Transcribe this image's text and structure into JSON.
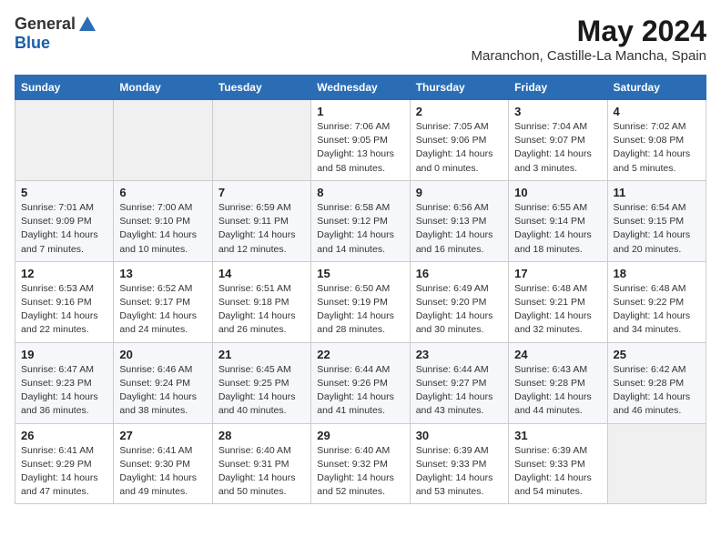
{
  "header": {
    "logo_general": "General",
    "logo_blue": "Blue",
    "main_title": "May 2024",
    "subtitle": "Maranchon, Castille-La Mancha, Spain"
  },
  "weekdays": [
    "Sunday",
    "Monday",
    "Tuesday",
    "Wednesday",
    "Thursday",
    "Friday",
    "Saturday"
  ],
  "weeks": [
    [
      {
        "day": "",
        "empty": true
      },
      {
        "day": "",
        "empty": true
      },
      {
        "day": "",
        "empty": true
      },
      {
        "day": "1",
        "info": "Sunrise: 7:06 AM\nSunset: 9:05 PM\nDaylight: 13 hours\nand 58 minutes."
      },
      {
        "day": "2",
        "info": "Sunrise: 7:05 AM\nSunset: 9:06 PM\nDaylight: 14 hours\nand 0 minutes."
      },
      {
        "day": "3",
        "info": "Sunrise: 7:04 AM\nSunset: 9:07 PM\nDaylight: 14 hours\nand 3 minutes."
      },
      {
        "day": "4",
        "info": "Sunrise: 7:02 AM\nSunset: 9:08 PM\nDaylight: 14 hours\nand 5 minutes."
      }
    ],
    [
      {
        "day": "5",
        "info": "Sunrise: 7:01 AM\nSunset: 9:09 PM\nDaylight: 14 hours\nand 7 minutes."
      },
      {
        "day": "6",
        "info": "Sunrise: 7:00 AM\nSunset: 9:10 PM\nDaylight: 14 hours\nand 10 minutes."
      },
      {
        "day": "7",
        "info": "Sunrise: 6:59 AM\nSunset: 9:11 PM\nDaylight: 14 hours\nand 12 minutes."
      },
      {
        "day": "8",
        "info": "Sunrise: 6:58 AM\nSunset: 9:12 PM\nDaylight: 14 hours\nand 14 minutes."
      },
      {
        "day": "9",
        "info": "Sunrise: 6:56 AM\nSunset: 9:13 PM\nDaylight: 14 hours\nand 16 minutes."
      },
      {
        "day": "10",
        "info": "Sunrise: 6:55 AM\nSunset: 9:14 PM\nDaylight: 14 hours\nand 18 minutes."
      },
      {
        "day": "11",
        "info": "Sunrise: 6:54 AM\nSunset: 9:15 PM\nDaylight: 14 hours\nand 20 minutes."
      }
    ],
    [
      {
        "day": "12",
        "info": "Sunrise: 6:53 AM\nSunset: 9:16 PM\nDaylight: 14 hours\nand 22 minutes."
      },
      {
        "day": "13",
        "info": "Sunrise: 6:52 AM\nSunset: 9:17 PM\nDaylight: 14 hours\nand 24 minutes."
      },
      {
        "day": "14",
        "info": "Sunrise: 6:51 AM\nSunset: 9:18 PM\nDaylight: 14 hours\nand 26 minutes."
      },
      {
        "day": "15",
        "info": "Sunrise: 6:50 AM\nSunset: 9:19 PM\nDaylight: 14 hours\nand 28 minutes."
      },
      {
        "day": "16",
        "info": "Sunrise: 6:49 AM\nSunset: 9:20 PM\nDaylight: 14 hours\nand 30 minutes."
      },
      {
        "day": "17",
        "info": "Sunrise: 6:48 AM\nSunset: 9:21 PM\nDaylight: 14 hours\nand 32 minutes."
      },
      {
        "day": "18",
        "info": "Sunrise: 6:48 AM\nSunset: 9:22 PM\nDaylight: 14 hours\nand 34 minutes."
      }
    ],
    [
      {
        "day": "19",
        "info": "Sunrise: 6:47 AM\nSunset: 9:23 PM\nDaylight: 14 hours\nand 36 minutes."
      },
      {
        "day": "20",
        "info": "Sunrise: 6:46 AM\nSunset: 9:24 PM\nDaylight: 14 hours\nand 38 minutes."
      },
      {
        "day": "21",
        "info": "Sunrise: 6:45 AM\nSunset: 9:25 PM\nDaylight: 14 hours\nand 40 minutes."
      },
      {
        "day": "22",
        "info": "Sunrise: 6:44 AM\nSunset: 9:26 PM\nDaylight: 14 hours\nand 41 minutes."
      },
      {
        "day": "23",
        "info": "Sunrise: 6:44 AM\nSunset: 9:27 PM\nDaylight: 14 hours\nand 43 minutes."
      },
      {
        "day": "24",
        "info": "Sunrise: 6:43 AM\nSunset: 9:28 PM\nDaylight: 14 hours\nand 44 minutes."
      },
      {
        "day": "25",
        "info": "Sunrise: 6:42 AM\nSunset: 9:28 PM\nDaylight: 14 hours\nand 46 minutes."
      }
    ],
    [
      {
        "day": "26",
        "info": "Sunrise: 6:41 AM\nSunset: 9:29 PM\nDaylight: 14 hours\nand 47 minutes."
      },
      {
        "day": "27",
        "info": "Sunrise: 6:41 AM\nSunset: 9:30 PM\nDaylight: 14 hours\nand 49 minutes."
      },
      {
        "day": "28",
        "info": "Sunrise: 6:40 AM\nSunset: 9:31 PM\nDaylight: 14 hours\nand 50 minutes."
      },
      {
        "day": "29",
        "info": "Sunrise: 6:40 AM\nSunset: 9:32 PM\nDaylight: 14 hours\nand 52 minutes."
      },
      {
        "day": "30",
        "info": "Sunrise: 6:39 AM\nSunset: 9:33 PM\nDaylight: 14 hours\nand 53 minutes."
      },
      {
        "day": "31",
        "info": "Sunrise: 6:39 AM\nSunset: 9:33 PM\nDaylight: 14 hours\nand 54 minutes."
      },
      {
        "day": "",
        "empty": true
      }
    ]
  ]
}
